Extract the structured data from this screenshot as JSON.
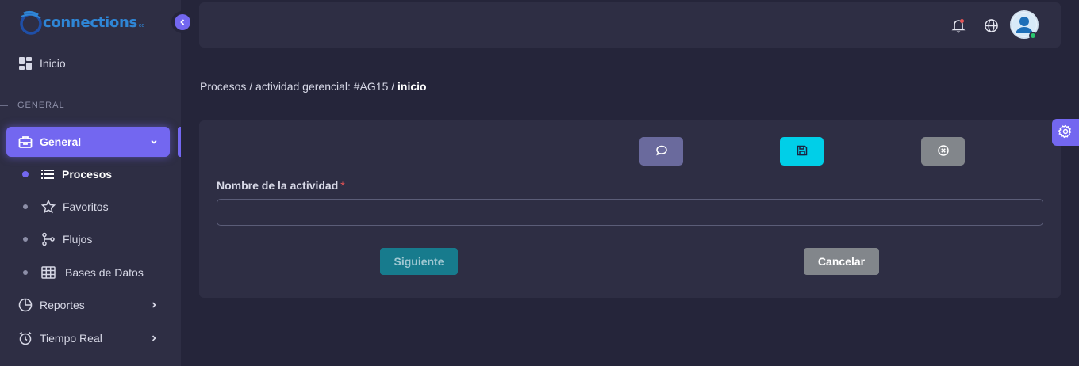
{
  "brand": {
    "name": "connections",
    "suffix": "co"
  },
  "sidebar": {
    "home_label": "Inicio",
    "section_label": "GENERAL",
    "general_label": "General",
    "subitems": [
      {
        "label": "Procesos",
        "icon": "list-icon",
        "active": true
      },
      {
        "label": "Favoritos",
        "icon": "star-icon",
        "active": false
      },
      {
        "label": "Flujos",
        "icon": "flow-icon",
        "active": false
      },
      {
        "label": "Bases de Datos",
        "icon": "table-icon",
        "active": false
      }
    ],
    "reports_label": "Reportes",
    "realtime_label": "Tiempo Real"
  },
  "breadcrumb": {
    "path": "Procesos / actividad gerencial: #AG15 / ",
    "current": "inicio"
  },
  "form": {
    "field_label": "Nombre de la actividad",
    "required_mark": "*",
    "field_value": "",
    "next_label": "Siguiente",
    "cancel_label": "Cancelar"
  },
  "colors": {
    "primary": "#7367f0",
    "info": "#00cfe8",
    "secondary": "#82868b",
    "danger": "#ea5455",
    "success": "#28c76f"
  }
}
